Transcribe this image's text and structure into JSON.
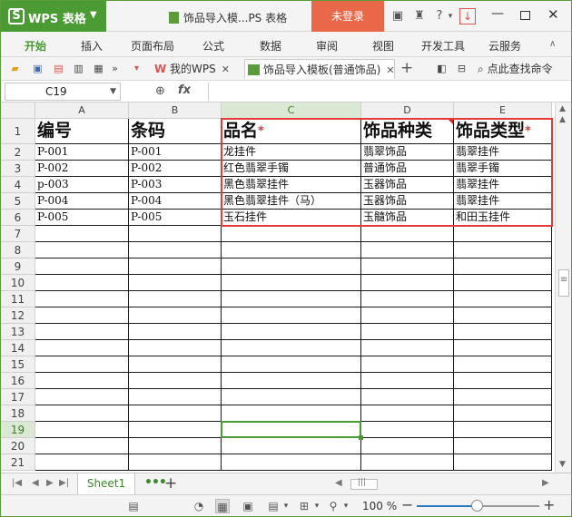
{
  "titlebar": {
    "app_name": "WPS 表格",
    "doc_title": "饰品导入模...PS 表格",
    "login_label": "未登录"
  },
  "menu": {
    "items": [
      "开始",
      "插入",
      "页面布局",
      "公式",
      "数据",
      "审阅",
      "视图",
      "开发工具",
      "云服务"
    ],
    "active_index": 0
  },
  "tabs": {
    "wps_tab": "我的WPS",
    "file_tab": "饰品导入模板(普通饰品)",
    "search_label": "点此查找命令"
  },
  "formula_bar": {
    "name_box": "C19",
    "fx_label": "fx",
    "formula": ""
  },
  "grid": {
    "columns": [
      "A",
      "B",
      "C",
      "D",
      "E"
    ],
    "rows": [
      "1",
      "2",
      "3",
      "4",
      "5",
      "6",
      "7",
      "8",
      "9",
      "10",
      "11",
      "12",
      "13",
      "14",
      "15",
      "16",
      "17",
      "18",
      "19",
      "20",
      "21"
    ],
    "header": [
      "编号",
      "条码",
      "品名",
      "饰品种类",
      "饰品类型"
    ],
    "required_marker": "*",
    "data": [
      [
        "P-001",
        "P-001",
        "龙挂件",
        "翡翠饰品",
        "翡翠挂件"
      ],
      [
        "P-002",
        "P-002",
        "红色翡翠手镯",
        "普通饰品",
        "翡翠手镯"
      ],
      [
        "p-003",
        "P-003",
        "黑色翡翠挂件",
        "玉器饰品",
        "翡翠挂件"
      ],
      [
        "P-004",
        "P-004",
        "黑色翡翠挂件（马）",
        "玉器饰品",
        "翡翠挂件"
      ],
      [
        "P-005",
        "P-005",
        "玉石挂件",
        "玉髓饰品",
        "和田玉挂件"
      ]
    ],
    "selected_cell": "C19"
  },
  "sheets": {
    "active": "Sheet1",
    "more_label": "•••",
    "add_label": "+"
  },
  "status": {
    "zoom": "100 %",
    "zoom_level": 1.0
  },
  "colors": {
    "accent_green": "#4a9b34",
    "login_orange": "#e9684a",
    "highlight_red": "#e63a3a",
    "required_red": "#e02020"
  }
}
